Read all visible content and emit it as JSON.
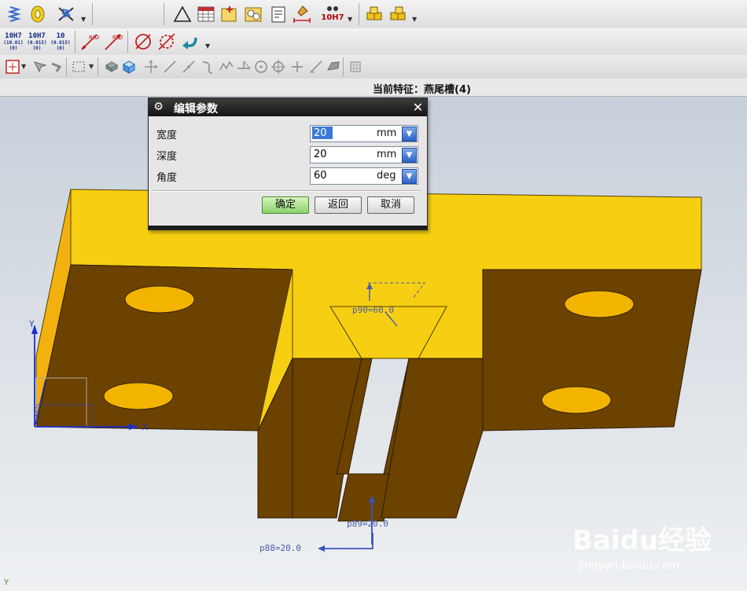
{
  "toolbar1": {
    "tol_label": "10H7"
  },
  "toolbar2": {
    "tol_a": "10H7",
    "tol_a_sub": "(10.01)\n(0)",
    "tol_b": "10H7",
    "tol_b_sub": "(0.015)\n(0)",
    "tol_c": "10",
    "tol_c_sub": "(0.015)\n(0)"
  },
  "status": {
    "current_feature": "当前特征：燕尾槽(4)"
  },
  "dialog": {
    "title": "编辑参数",
    "rows": [
      {
        "label": "宽度",
        "value": "20",
        "unit": "mm"
      },
      {
        "label": "深度",
        "value": "20",
        "unit": "mm"
      },
      {
        "label": "角度",
        "value": "60",
        "unit": "deg"
      }
    ],
    "ok_label": "确定",
    "back_label": "返回",
    "cancel_label": "取消"
  },
  "annotations": {
    "p90": "p90=60.0",
    "p89": "p89=20.0",
    "p88": "p88=20.0",
    "axis_x": "X",
    "axis_y": "Y",
    "corner_y": "Y"
  },
  "watermark": {
    "logo": "Baidu经验",
    "url": "jingyan.baidu.com"
  },
  "colors": {
    "part_top": "#f7c51a",
    "part_face": "#6b4200",
    "hole": "#f3b400",
    "dialog_title": "#1d1d1d",
    "ok_button": "#8bd26d"
  }
}
